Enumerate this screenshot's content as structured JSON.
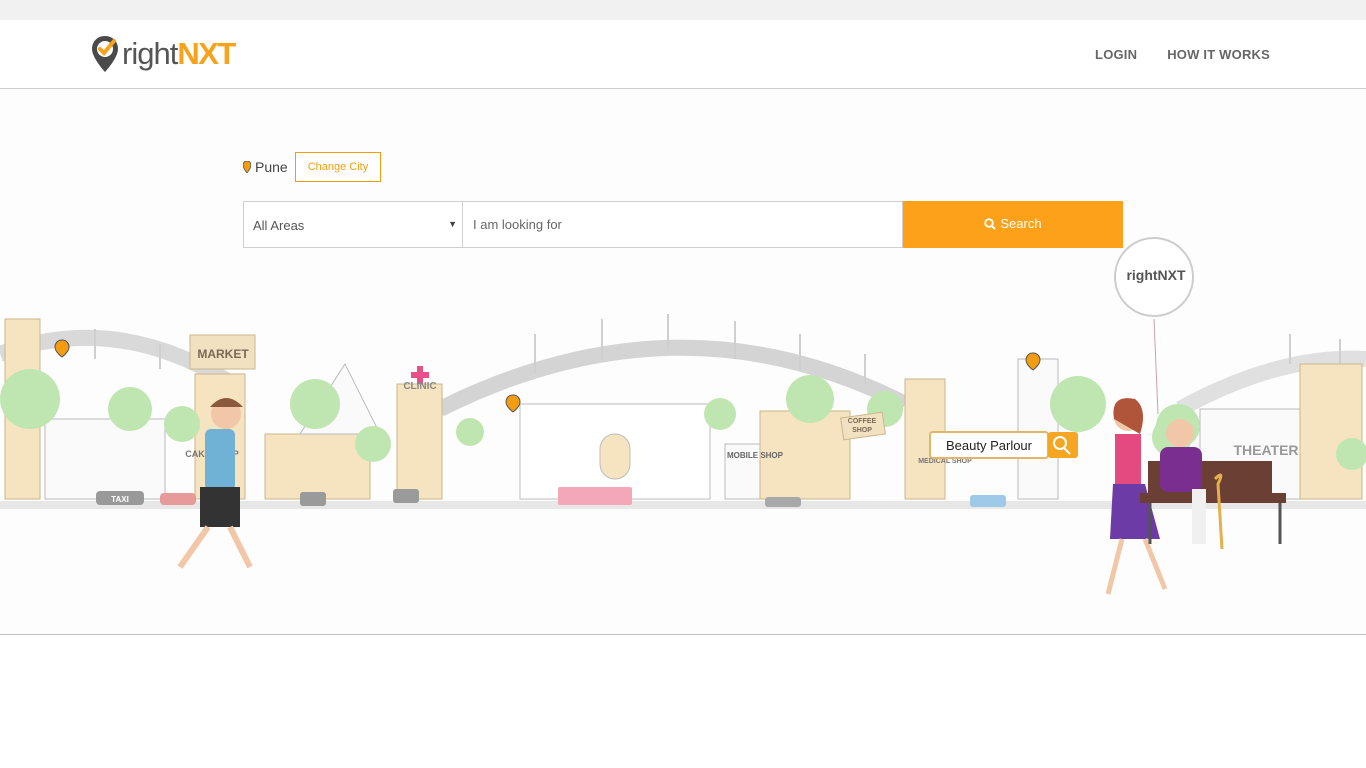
{
  "brand": {
    "logo_main": "right",
    "logo_accent": "NXT",
    "brand_color": "#f7a21b",
    "balloon_text": "rightNXT"
  },
  "nav": {
    "login": "LOGIN",
    "how_it_works": "HOW IT WORKS"
  },
  "location": {
    "city": "Pune",
    "change_city_label": "Change City"
  },
  "search": {
    "area_value": "All Areas",
    "query_placeholder": "I am looking for",
    "button_label": "Search",
    "button_color": "#fda11a"
  },
  "illustration": {
    "signs": {
      "market": "MARKET",
      "clinic": "CLINIC",
      "cake_shop": "CAKE SHOP",
      "mobile_shop": "MOBILE SHOP",
      "coffee_shop_line1": "COFFEE",
      "coffee_shop_line2": "SHOP",
      "medical_shop": "MEDICAL SHOP",
      "theater": "THEATER",
      "taxi": "TAXI"
    },
    "search_bubble": "Beauty Parlour"
  }
}
